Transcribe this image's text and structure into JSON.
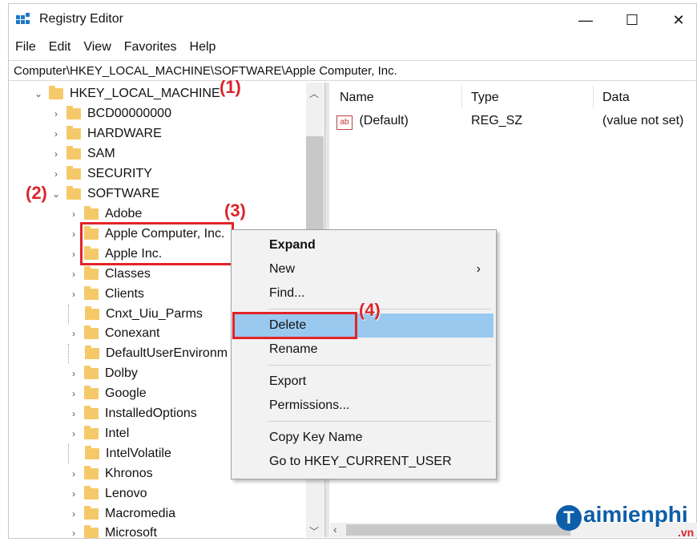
{
  "window": {
    "title": "Registry Editor",
    "minimize": "—",
    "maximize": "☐",
    "close": "✕"
  },
  "menu": [
    "File",
    "Edit",
    "View",
    "Favorites",
    "Help"
  ],
  "address": "Computer\\HKEY_LOCAL_MACHINE\\SOFTWARE\\Apple Computer, Inc.",
  "tree": {
    "root": "HKEY_LOCAL_MACHINE",
    "level1": [
      "BCD00000000",
      "HARDWARE",
      "SAM",
      "SECURITY",
      "SOFTWARE"
    ],
    "software_children": [
      "Adobe",
      "Apple Computer, Inc.",
      "Apple Inc.",
      "Classes",
      "Clients",
      "Cnxt_Uiu_Parms",
      "Conexant",
      "DefaultUserEnvironm",
      "Dolby",
      "Google",
      "InstalledOptions",
      "Intel",
      "IntelVolatile",
      "Khronos",
      "Lenovo",
      "Macromedia",
      "Microsoft"
    ]
  },
  "list": {
    "headers": {
      "name": "Name",
      "type": "Type",
      "data": "Data"
    },
    "rows": [
      {
        "icon": "ab",
        "name": "(Default)",
        "type": "REG_SZ",
        "data": "(value not set)"
      }
    ]
  },
  "context_menu": {
    "expand": "Expand",
    "new": "New",
    "find": "Find...",
    "delete": "Delete",
    "rename": "Rename",
    "export": "Export",
    "permissions": "Permissions...",
    "copy_key_name": "Copy Key Name",
    "goto": "Go to HKEY_CURRENT_USER",
    "submenu_arrow": "›"
  },
  "annotations": [
    "(1)",
    "(2)",
    "(3)",
    "(4)"
  ],
  "watermark": {
    "logo": "T",
    "text": "aimienphi",
    "sub": ".vn"
  },
  "colors": {
    "highlight": "#99c9ef",
    "annotation_red": "#e32329",
    "folder": "#f5c96a",
    "watermark_blue": "#0d5ea8"
  }
}
